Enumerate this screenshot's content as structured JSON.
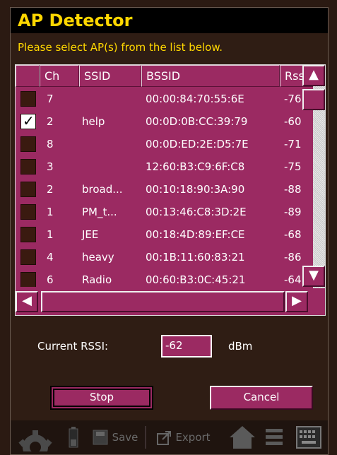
{
  "window": {
    "title": "AP Detector",
    "prompt": "Please select AP(s) from the list below."
  },
  "table": {
    "columns": [
      "",
      "Ch",
      "SSID",
      "BSSID",
      "Rss"
    ],
    "rows": [
      {
        "checked": false,
        "ch": "7",
        "ssid": "",
        "bssid": "00:00:84:70:55:6E",
        "rssi": "-76"
      },
      {
        "checked": true,
        "ch": "2",
        "ssid": "help",
        "bssid": "00:0D:0B:CC:39:79",
        "rssi": "-60"
      },
      {
        "checked": false,
        "ch": "8",
        "ssid": "",
        "bssid": "00:0D:ED:2E:D5:7E",
        "rssi": "-71"
      },
      {
        "checked": false,
        "ch": "3",
        "ssid": "",
        "bssid": "12:60:B3:C9:6F:C8",
        "rssi": "-75"
      },
      {
        "checked": false,
        "ch": "2",
        "ssid": "broad...",
        "bssid": "00:10:18:90:3A:90",
        "rssi": "-88"
      },
      {
        "checked": false,
        "ch": "1",
        "ssid": "PM_t...",
        "bssid": "00:13:46:C8:3D:2E",
        "rssi": "-89"
      },
      {
        "checked": false,
        "ch": "1",
        "ssid": "JEE",
        "bssid": "00:18:4D:89:EF:CE",
        "rssi": "-68"
      },
      {
        "checked": false,
        "ch": "4",
        "ssid": "heavy",
        "bssid": "00:1B:11:60:83:21",
        "rssi": "-86"
      },
      {
        "checked": false,
        "ch": "6",
        "ssid": "Radio",
        "bssid": "00:60:B3:0C:45:21",
        "rssi": "-64"
      }
    ]
  },
  "scroll": {
    "up_icon": "▲",
    "down_icon": "▼",
    "left_icon": "◀",
    "right_icon": "▶"
  },
  "rssi": {
    "label": "Current RSSI:",
    "value": "-62",
    "unit": "dBm"
  },
  "buttons": {
    "stop": "Stop",
    "cancel": "Cancel"
  },
  "toolbar": {
    "save": "Save",
    "export": "Export",
    "icons": [
      "gear-icon",
      "battery-icon",
      "disk-icon",
      "export-icon",
      "home-icon",
      "menu-icon",
      "keyboard-icon"
    ]
  },
  "colors": {
    "accent": "#9b2a62",
    "title_text": "#ffd700",
    "background": "#2f1d14"
  }
}
